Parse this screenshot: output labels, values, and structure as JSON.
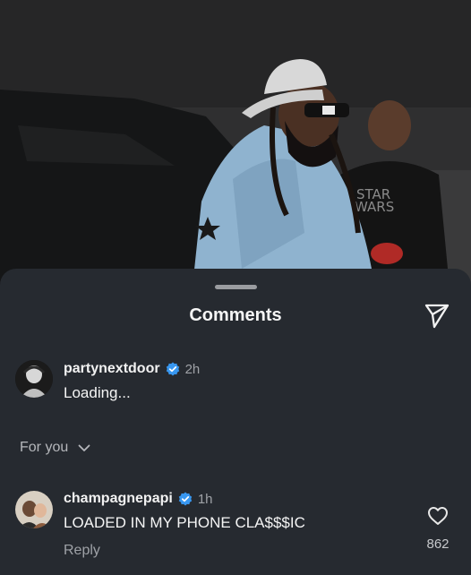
{
  "sheet": {
    "title": "Comments"
  },
  "pinned_comment": {
    "username": "partynextdoor",
    "verified": true,
    "time": "2h",
    "text": "Loading..."
  },
  "filter": {
    "label": "For you"
  },
  "comments": [
    {
      "username": "champagnepapi",
      "verified": true,
      "time": "1h",
      "text": "LOADED IN MY PHONE CLA$$$IC",
      "reply_label": "Reply",
      "likes": "862"
    }
  ],
  "colors": {
    "sheet_background": "#262a30",
    "verified_badge": "#3897f0",
    "muted_text": "#9fa2a7"
  },
  "icons": {
    "send": "paper-plane-icon",
    "verified": "verified-badge-icon",
    "chevron": "chevron-down-icon",
    "like": "heart-outline-icon"
  }
}
